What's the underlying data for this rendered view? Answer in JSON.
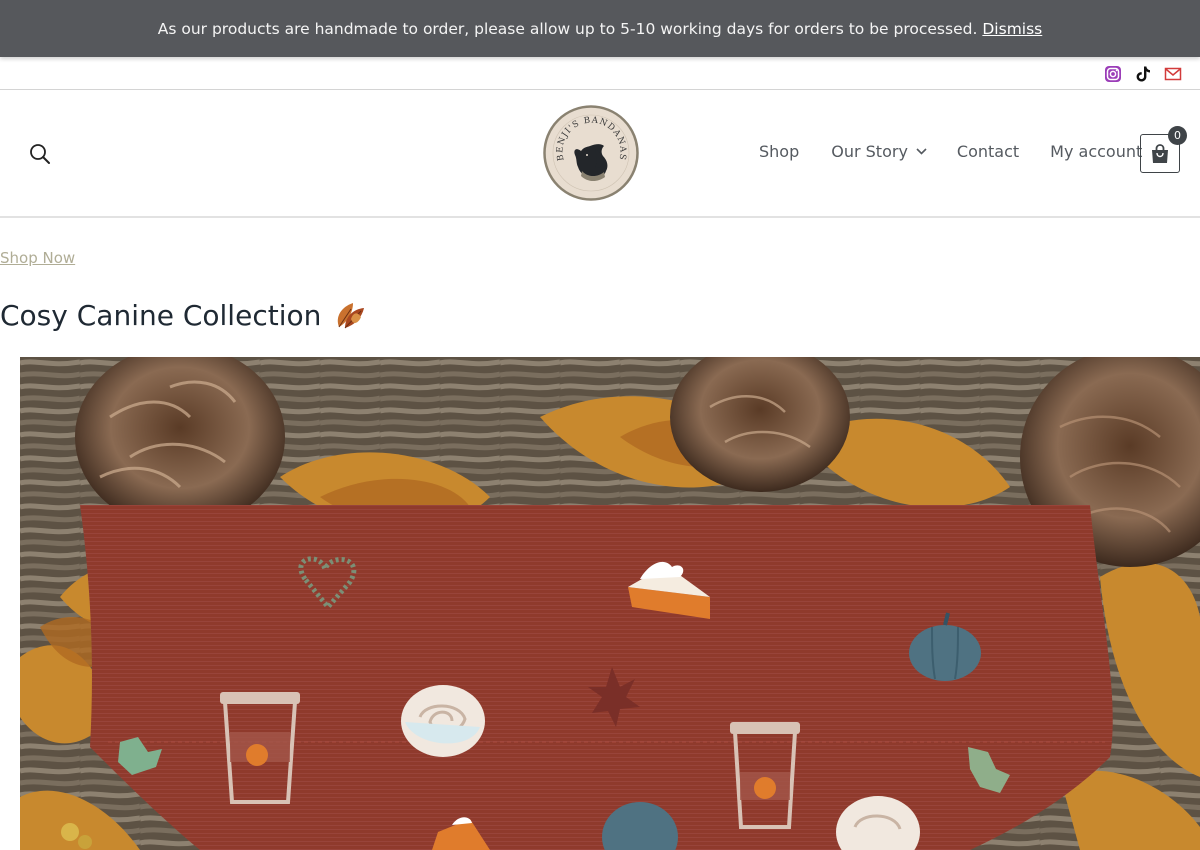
{
  "notice": {
    "text": "As our products are handmade to order, please allow up to 5-10 working days for orders to be processed.",
    "dismiss_label": "Dismiss"
  },
  "social": {
    "icons": [
      "instagram-icon",
      "tiktok-icon",
      "email-icon"
    ]
  },
  "header": {
    "logo_text": "BENJI'S BANDANAS",
    "nav": {
      "shop": "Shop",
      "story": "Our Story",
      "contact": "Contact",
      "account": "My account"
    },
    "cart_count": "0"
  },
  "content": {
    "shop_now": "Shop Now",
    "heading": "Cosy Canine Collection"
  },
  "colors": {
    "notice_bg": "#56585c",
    "link_muted": "#b0ad96",
    "nav_text": "#555a60",
    "bandana": "#8f3a2c",
    "logo_bg": "#e8ddd0"
  }
}
